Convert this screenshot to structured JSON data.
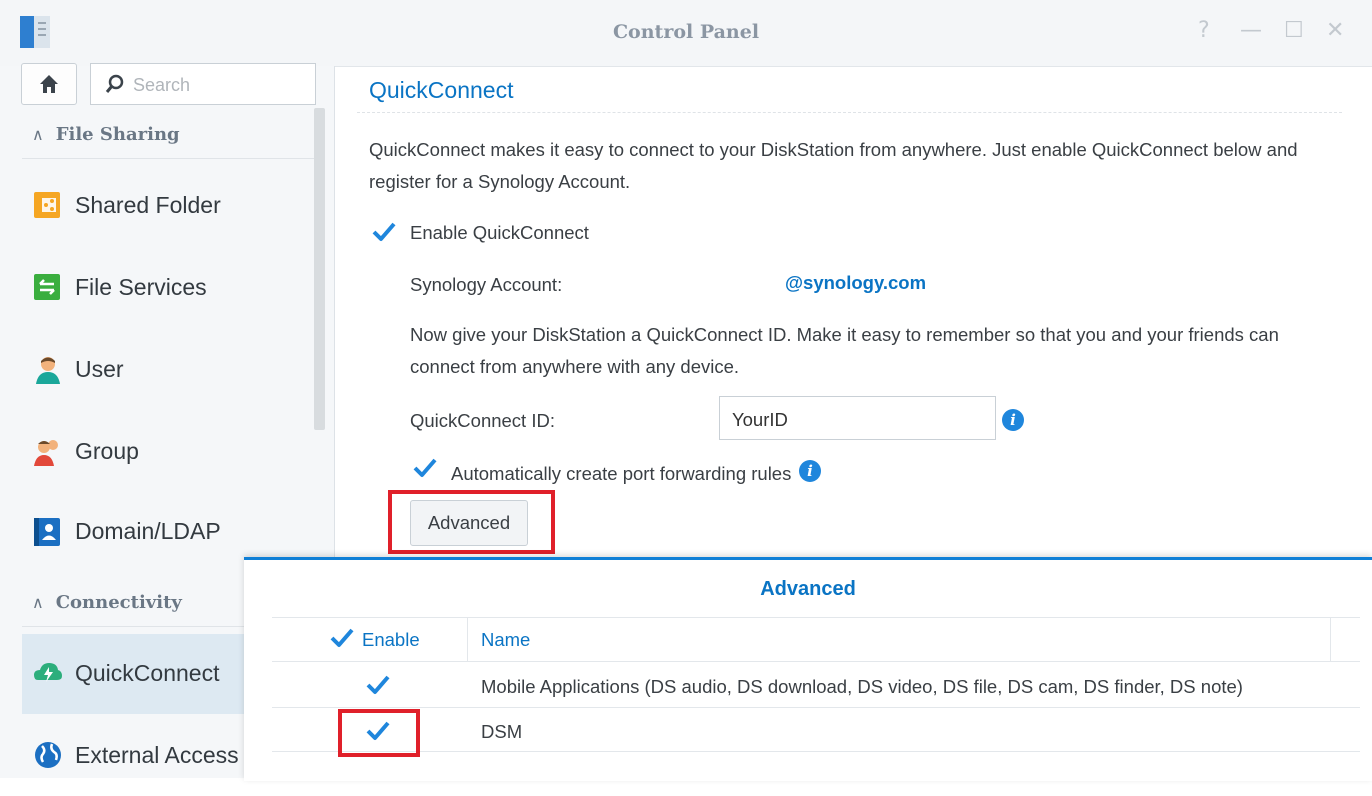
{
  "window": {
    "title": "Control Panel",
    "controls": [
      "?",
      "—",
      "☐",
      "✕"
    ]
  },
  "sidebar": {
    "search_placeholder": "Search",
    "sections": [
      {
        "label": "File Sharing"
      },
      {
        "label": "Connectivity"
      }
    ],
    "items": [
      {
        "label": "Shared Folder",
        "icon": "shared-folder-icon"
      },
      {
        "label": "File Services",
        "icon": "file-services-icon"
      },
      {
        "label": "User",
        "icon": "user-icon"
      },
      {
        "label": "Group",
        "icon": "group-icon"
      },
      {
        "label": "Domain/LDAP",
        "icon": "domain-ldap-icon"
      },
      {
        "label": "QuickConnect",
        "icon": "quickconnect-icon",
        "active": true
      },
      {
        "label": "External Access",
        "icon": "external-access-icon"
      }
    ]
  },
  "main": {
    "title": "QuickConnect",
    "intro_line1": "QuickConnect makes it easy to connect to your DiskStation from anywhere. Just enable QuickConnect below and",
    "intro_line2": "register for a Synology Account.",
    "enable_label": "Enable QuickConnect",
    "enable_checked": true,
    "account_label": "Synology Account:",
    "account_value": "@synology.com",
    "id_intro_line1": "Now give your DiskStation a QuickConnect ID. Make it easy to remember so that you and your friends can",
    "id_intro_line2": "connect from anywhere with any device.",
    "id_label": "QuickConnect ID:",
    "id_value": "YourID",
    "port_forward_label": "Automatically create port forwarding rules",
    "port_forward_checked": true,
    "advanced_button": "Advanced"
  },
  "dialog": {
    "title": "Advanced",
    "columns": {
      "enable": "Enable",
      "name": "Name"
    },
    "rows": [
      {
        "enabled": true,
        "name": "Mobile Applications (DS audio, DS download, DS video, DS file, DS cam, DS finder, DS note)"
      },
      {
        "enabled": true,
        "name": "DSM"
      }
    ]
  },
  "colors": {
    "accent": "#0a74c4",
    "highlight": "#e0202a",
    "active_nav": "#dde9f2"
  }
}
